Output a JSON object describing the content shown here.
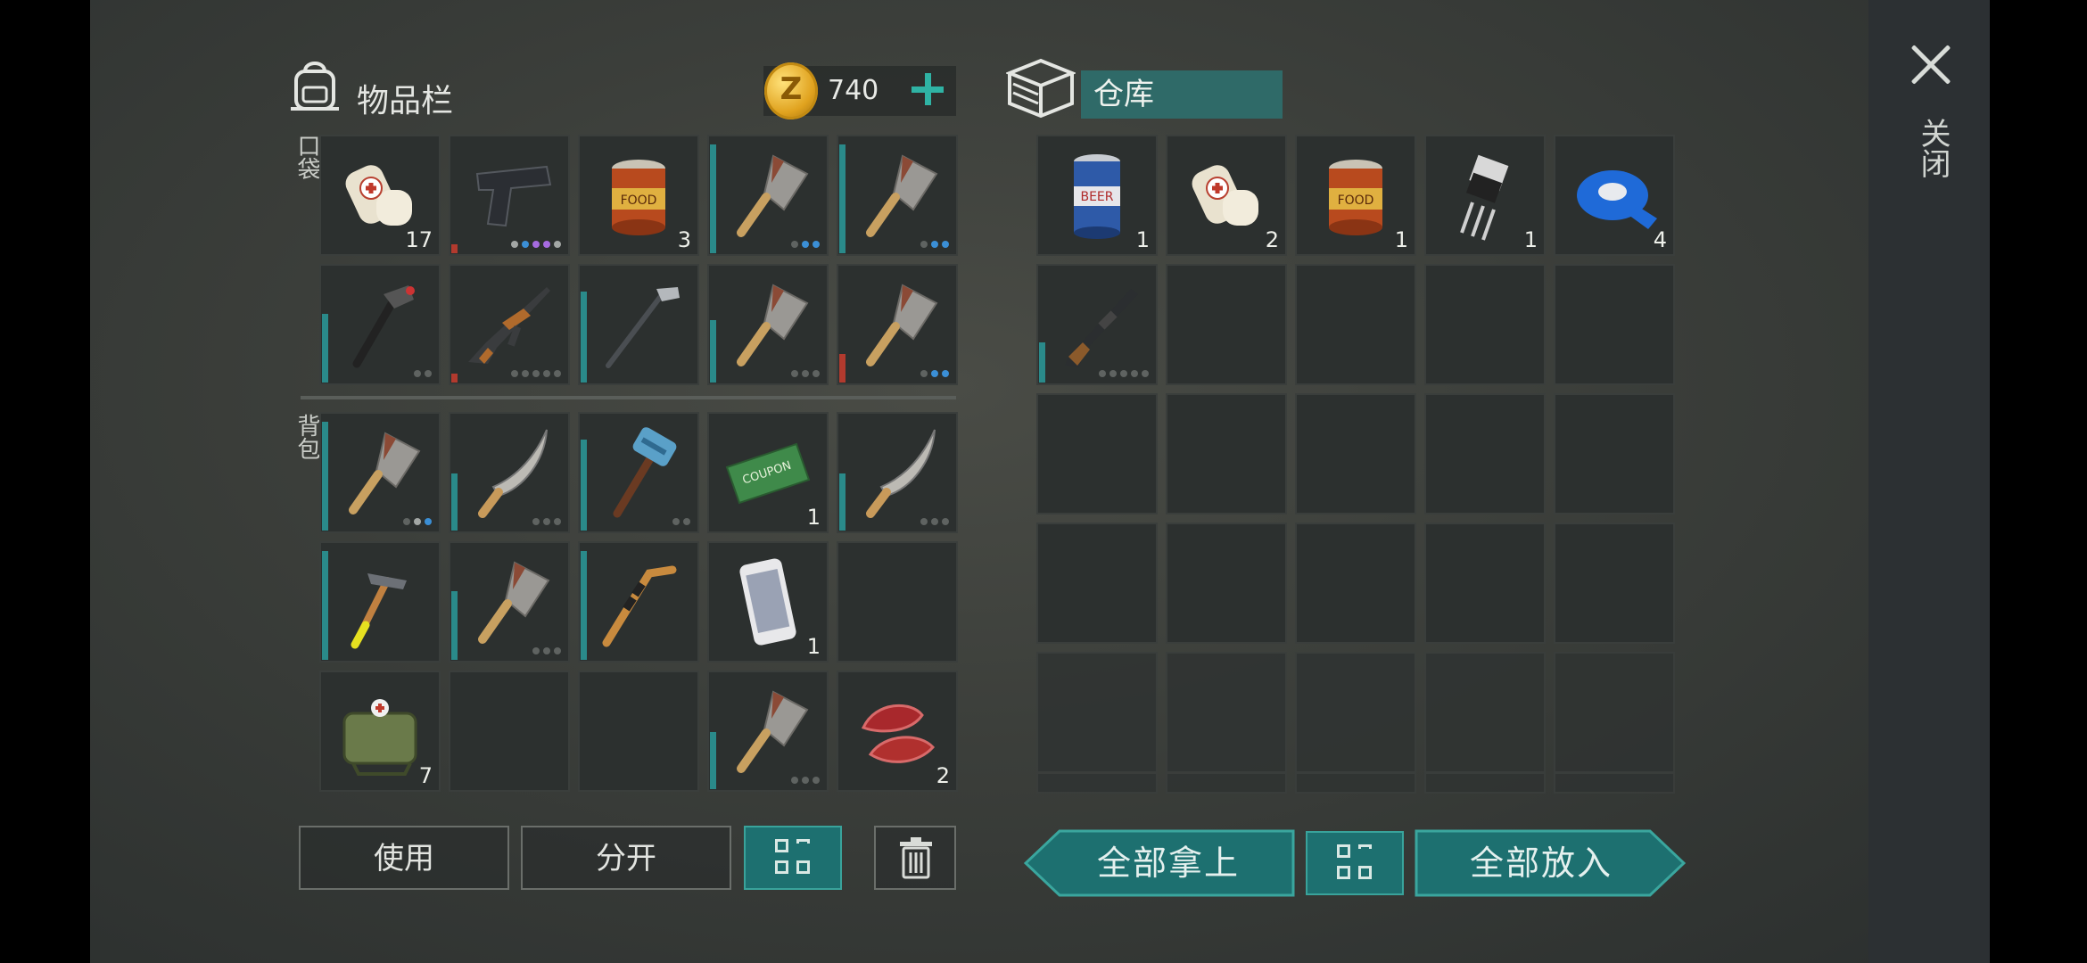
{
  "inventory": {
    "title": "物品栏",
    "pocket_label": "口袋",
    "backpack_label": "背包",
    "currency": "740",
    "currency_symbol": "Z",
    "pocket_slots": [
      {
        "icon": "bandage-icon",
        "count": "17",
        "bar": 0
      },
      {
        "icon": "pistol-icon",
        "count": "",
        "dots": [
          "lt",
          "blue",
          "purple",
          "purple",
          "lt"
        ],
        "bar": 0.08,
        "bar_color": "red"
      },
      {
        "icon": "canned-food-icon",
        "count": "3",
        "bar": 0
      },
      {
        "icon": "cleaver-icon",
        "count": "",
        "dots": [
          "d",
          "blue",
          "blue"
        ],
        "bar": 0.95
      },
      {
        "icon": "cleaver-icon",
        "count": "",
        "dots": [
          "d",
          "blue",
          "blue"
        ],
        "bar": 0.95
      },
      {
        "icon": "hammer-icon",
        "count": "",
        "dots": [
          "d",
          "d"
        ],
        "bar": 0.6
      },
      {
        "icon": "ak-rifle-icon",
        "count": "",
        "dots": [
          "d",
          "d",
          "d",
          "d",
          "d"
        ],
        "bar": 0.08,
        "bar_color": "red"
      },
      {
        "icon": "golf-club-icon",
        "count": "",
        "bar": 0.8
      },
      {
        "icon": "cleaver-icon",
        "count": "",
        "dots": [
          "d",
          "d",
          "d"
        ],
        "bar": 0.55
      },
      {
        "icon": "cleaver-icon",
        "count": "",
        "dots": [
          "d",
          "blue",
          "blue"
        ],
        "bar": 0.25,
        "bar_color": "red"
      }
    ],
    "backpack_slots": [
      {
        "icon": "cleaver-icon",
        "count": "",
        "dots": [
          "d",
          "lt",
          "blue"
        ],
        "bar": 0.95
      },
      {
        "icon": "machete-icon",
        "count": "",
        "dots": [
          "d",
          "d",
          "d"
        ],
        "bar": 0.5
      },
      {
        "icon": "sledgehammer-icon",
        "count": "",
        "dots": [
          "d",
          "d"
        ],
        "bar": 0.8
      },
      {
        "icon": "ration-coupon-icon",
        "count": "1",
        "bar": 0
      },
      {
        "icon": "machete-icon",
        "count": "",
        "dots": [
          "d",
          "d",
          "d"
        ],
        "bar": 0.5
      },
      {
        "icon": "claw-hammer-icon",
        "count": "",
        "bar": 0.95
      },
      {
        "icon": "cleaver-icon",
        "count": "",
        "dots": [
          "d",
          "d",
          "d"
        ],
        "bar": 0.6
      },
      {
        "icon": "hockey-stick-icon",
        "count": "",
        "bar": 0.95
      },
      {
        "icon": "smartphone-icon",
        "count": "1",
        "bar": 0
      },
      {
        "icon": "",
        "count": "",
        "bar": 0
      },
      {
        "icon": "medkit-bag-icon",
        "count": "7",
        "bar": 0
      },
      {
        "icon": "",
        "count": "",
        "bar": 0
      },
      {
        "icon": "",
        "count": "",
        "bar": 0
      },
      {
        "icon": "cleaver-icon",
        "count": "",
        "dots": [
          "d",
          "d",
          "d"
        ],
        "bar": 0.5
      },
      {
        "icon": "raw-meat-icon",
        "count": "2",
        "bar": 0
      }
    ],
    "buttons": {
      "use": "使用",
      "split": "分开"
    }
  },
  "storage": {
    "title": "仓库",
    "slots": [
      {
        "icon": "beer-can-icon",
        "count": "1",
        "bar": 0
      },
      {
        "icon": "bandage-icon",
        "count": "2",
        "bar": 0
      },
      {
        "icon": "canned-food-icon",
        "count": "1",
        "bar": 0
      },
      {
        "icon": "transistor-icon",
        "count": "1",
        "bar": 0
      },
      {
        "icon": "blue-tape-icon",
        "count": "4",
        "bar": 0
      },
      {
        "icon": "shotgun-icon",
        "count": "",
        "dots": [
          "d",
          "d",
          "d",
          "d",
          "d"
        ],
        "bar": 0.35
      }
    ],
    "buttons": {
      "take_all": "全部拿上",
      "put_all": "全部放入"
    }
  },
  "sidebar": {
    "close_label": "关闭"
  },
  "colors": {
    "accent": "#1d7070",
    "bar": "#2a8a8a",
    "bar_red": "#b23a2e",
    "coin": "#e0a21e"
  }
}
